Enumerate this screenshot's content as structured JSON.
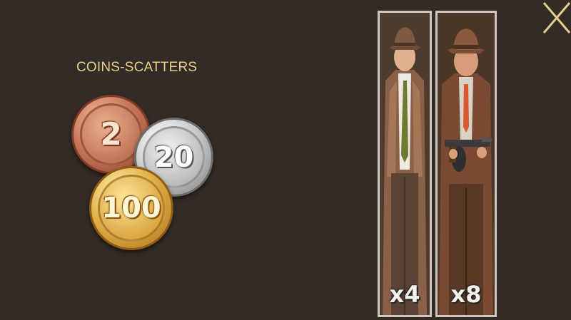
{
  "scatters": {
    "title": "COINS-SCATTERS",
    "coins": [
      {
        "name": "copper-coin",
        "value": "2"
      },
      {
        "name": "silver-coin",
        "value": "20"
      },
      {
        "name": "gold-coin",
        "value": "100"
      }
    ]
  },
  "reels": [
    {
      "character": "detective-with-striped-tie",
      "multiplier": "x4"
    },
    {
      "character": "gangster-with-tommy-gun",
      "multiplier": "x8"
    }
  ],
  "close": {
    "icon": "close-icon",
    "color": "#e8cf8a"
  },
  "colors": {
    "background": "#332b25",
    "title": "#e8cf8a"
  }
}
